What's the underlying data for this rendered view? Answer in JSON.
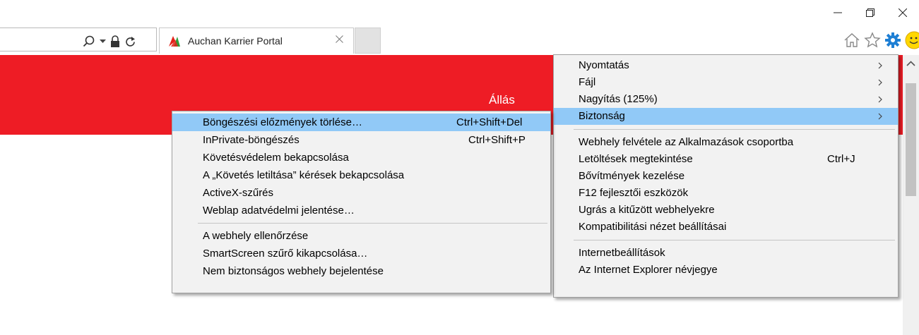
{
  "tab": {
    "title": "Auchan Karrier Portal"
  },
  "page": {
    "banner_text": "Állás"
  },
  "main_menu": {
    "items": [
      {
        "label": "Nyomtatás",
        "shortcut": "",
        "submenu": true
      },
      {
        "label": "Fájl",
        "shortcut": "",
        "submenu": true
      },
      {
        "label": "Nagyítás (125%)",
        "shortcut": "",
        "submenu": true
      },
      {
        "label": "Biztonság",
        "shortcut": "",
        "submenu": true
      },
      {
        "label": "Webhely felvétele az Alkalmazások csoportba",
        "shortcut": ""
      },
      {
        "label": "Letöltések megtekintése",
        "shortcut": "Ctrl+J"
      },
      {
        "label": "Bővítmények kezelése",
        "shortcut": ""
      },
      {
        "label": "F12 fejlesztői eszközök",
        "shortcut": ""
      },
      {
        "label": "Ugrás a kitűzött webhelyekre",
        "shortcut": ""
      },
      {
        "label": "Kompatibilitási nézet beállításai",
        "shortcut": ""
      },
      {
        "label": "Internetbeállítások",
        "shortcut": ""
      },
      {
        "label": "Az Internet Explorer névjegye",
        "shortcut": ""
      }
    ]
  },
  "security_menu": {
    "items": [
      {
        "label": "Böngészési előzmények törlése…",
        "shortcut": "Ctrl+Shift+Del"
      },
      {
        "label": "InPrivate-böngészés",
        "shortcut": "Ctrl+Shift+P"
      },
      {
        "label": "Követésvédelem bekapcsolása",
        "shortcut": ""
      },
      {
        "label": "A „Követés letiltása” kérések bekapcsolása",
        "shortcut": ""
      },
      {
        "label": "ActiveX-szűrés",
        "shortcut": ""
      },
      {
        "label": "Weblap adatvédelmi jelentése…",
        "shortcut": ""
      },
      {
        "label": "A webhely ellenőrzése",
        "shortcut": ""
      },
      {
        "label": "SmartScreen szűrő kikapcsolása…",
        "shortcut": ""
      },
      {
        "label": "Nem biztonságos webhely bejelentése",
        "shortcut": ""
      }
    ]
  },
  "colors": {
    "banner": "#ee1c25",
    "menu_highlight": "#91c9f7",
    "menu_background": "#f2f2f2",
    "gear": "#1e7fd4",
    "smiley": "#ffd700"
  },
  "icons": [
    "minimize-icon",
    "restore-icon",
    "close-icon",
    "search-icon",
    "dropdown-arrow-icon",
    "lock-icon",
    "refresh-icon",
    "auchan-favicon",
    "tab-close-icon",
    "home-icon",
    "favorites-star-icon",
    "gear-icon",
    "smiley-feedback-icon",
    "chevron-right-icon",
    "scroll-up-icon"
  ]
}
